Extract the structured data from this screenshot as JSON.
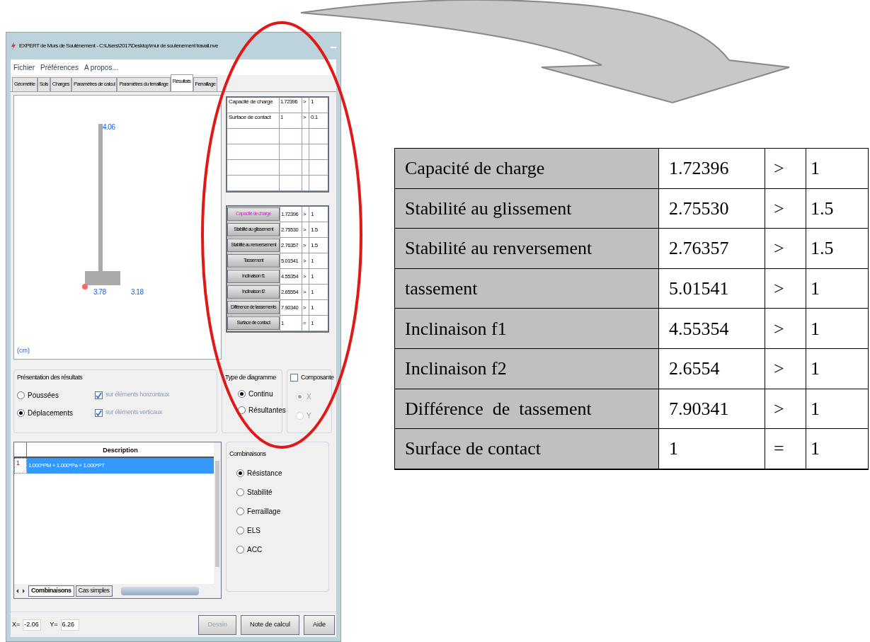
{
  "window": {
    "title": "EXPERT de Murs de Soutènement - C:\\Users\\2017\\Desktop\\mur de soutenement travail.nve"
  },
  "menu": [
    "Fichier",
    "Préférences",
    "A propos..."
  ],
  "tabs": [
    {
      "label": "Géométrie",
      "selected": false
    },
    {
      "label": "Sols",
      "selected": false
    },
    {
      "label": "Charges",
      "selected": false
    },
    {
      "label": "Paramètres de calcul",
      "selected": false
    },
    {
      "label": "Paramètres du ferraillage",
      "selected": false
    },
    {
      "label": "Résultats",
      "selected": true
    },
    {
      "label": "Ferraillage",
      "selected": false
    }
  ],
  "diagram": {
    "top_value": "4.06",
    "left_value": "3.78",
    "right_value": "3.18",
    "unit": "(cm)"
  },
  "criteria_table": [
    {
      "label": "Capacité de charge",
      "value": "1.72396",
      "op": ">",
      "limit": "1"
    },
    {
      "label": "Surface de contact",
      "value": "1",
      "op": ">",
      "limit": "0.1"
    }
  ],
  "checks": [
    {
      "label": "Capacité de charge",
      "value": "1.72396",
      "op": ">",
      "limit": "1",
      "highlighted": true
    },
    {
      "label": "Stabilité au glissement",
      "value": "2.75530",
      "op": ">",
      "limit": "1.5",
      "highlighted": false
    },
    {
      "label": "Stabilité au renversement",
      "value": "2.76357",
      "op": ">",
      "limit": "1.5",
      "highlighted": false
    },
    {
      "label": "Tassement",
      "value": "5.01541",
      "op": ">",
      "limit": "1",
      "highlighted": false
    },
    {
      "label": "Inclinaison f1",
      "value": "4.55354",
      "op": ">",
      "limit": "1",
      "highlighted": false
    },
    {
      "label": "Inclinaison f2",
      "value": "2.65554",
      "op": ">",
      "limit": "1",
      "highlighted": false
    },
    {
      "label": "Différence de tassements",
      "value": "7.90340",
      "op": ">",
      "limit": "1",
      "highlighted": false
    },
    {
      "label": "Surface de contact",
      "value": "1",
      "op": "=",
      "limit": "1",
      "highlighted": false
    }
  ],
  "presentation": {
    "title": "Présentation des résultats",
    "options": [
      {
        "label": "Poussées",
        "selected": false
      },
      {
        "label": "Déplacements",
        "selected": true
      }
    ],
    "checkboxes": [
      {
        "label": "sur éléments horizontaux",
        "checked": true,
        "disabled": true
      },
      {
        "label": "sur éléments verticaux",
        "checked": true,
        "disabled": true
      }
    ]
  },
  "diagram_type": {
    "title": "Type de diagramme",
    "options": [
      {
        "label": "Continu",
        "selected": true
      },
      {
        "label": "Résultantes",
        "selected": false
      }
    ]
  },
  "component": {
    "title": "Composante",
    "checked": false,
    "options": [
      {
        "label": "X",
        "selected": true,
        "disabled": true
      },
      {
        "label": "Y",
        "selected": false,
        "disabled": true
      }
    ]
  },
  "list": {
    "header": "Description",
    "rows": [
      {
        "index": "1",
        "description": "1.000*PM + 1.000*Pa + 1.000*PT",
        "selected": true
      }
    ],
    "sheet_tabs": [
      {
        "label": "Combinaisons",
        "selected": true
      },
      {
        "label": "Cas simples",
        "selected": false
      }
    ]
  },
  "combinations": {
    "title": "Combinaisons",
    "options": [
      {
        "label": "Résistance",
        "selected": true
      },
      {
        "label": "Stabilité",
        "selected": false
      },
      {
        "label": "Ferraillage",
        "selected": false
      },
      {
        "label": "ELS",
        "selected": false
      },
      {
        "label": "ACC",
        "selected": false
      }
    ]
  },
  "status": {
    "x_label": "X=",
    "x_value": "-2.06",
    "y_label": "Y=",
    "y_value": "6.26"
  },
  "buttons": [
    {
      "label": "Dessin",
      "disabled": true
    },
    {
      "label": "Note de calcul",
      "disabled": false
    },
    {
      "label": "Aide",
      "disabled": false
    }
  ],
  "summary_table": [
    {
      "label": "Capacité de charge",
      "value": "1.72396",
      "op": ">",
      "limit": "1"
    },
    {
      "label": "Stabilité au glissement",
      "value": "2.75530",
      "op": ">",
      "limit": "1.5"
    },
    {
      "label": "Stabilité au renversement",
      "value": "2.76357",
      "op": ">",
      "limit": "1.5"
    },
    {
      "label": "tassement",
      "value": "5.01541",
      "op": ">",
      "limit": "1"
    },
    {
      "label": "Inclinaison f1",
      "value": "4.55354",
      "op": ">",
      "limit": "1"
    },
    {
      "label": "Inclinaison f2",
      "value": "2.6554",
      "op": ">",
      "limit": "1"
    },
    {
      "label": "Différence  de  tassement",
      "value": "7.90341",
      "op": ">",
      "limit": "1"
    },
    {
      "label": "Surface de contact",
      "value": "1",
      "op": "=",
      "limit": "1"
    }
  ]
}
